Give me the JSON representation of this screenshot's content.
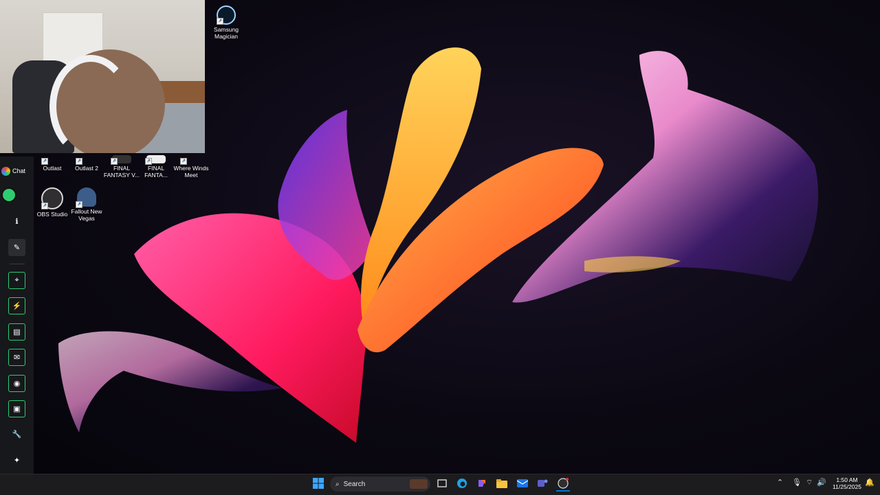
{
  "desktop": {
    "icons": [
      {
        "label": "Samsung Magician",
        "icon": "samsung-magician-icon"
      },
      {
        "label": "Outlast",
        "icon": "outlast-icon"
      },
      {
        "label": "Outlast 2",
        "icon": "outlast-2-icon"
      },
      {
        "label": "FINAL FANTASY V...",
        "icon": "final-fantasy-icon"
      },
      {
        "label": "FINAL FANTA...",
        "icon": "final-fantasy-2-icon"
      },
      {
        "label": "Where Winds Meet",
        "icon": "where-winds-meet-icon"
      },
      {
        "label": "OBS Studio",
        "icon": "obs-studio-icon"
      },
      {
        "label": "Fallout New Vegas",
        "icon": "fallout-new-vegas-icon"
      }
    ]
  },
  "rail": {
    "chat_label": "Chat",
    "tools": [
      {
        "name": "info",
        "glyph": "ℹ"
      },
      {
        "name": "edit",
        "glyph": "✎"
      },
      {
        "name": "screenshot",
        "glyph": "⌖"
      },
      {
        "name": "flash",
        "glyph": "⚡"
      },
      {
        "name": "notes",
        "glyph": "▤"
      },
      {
        "name": "message",
        "glyph": "✉"
      },
      {
        "name": "broadcast",
        "glyph": "◉"
      },
      {
        "name": "layers",
        "glyph": "▣"
      },
      {
        "name": "wrench",
        "glyph": "🔧"
      },
      {
        "name": "apps",
        "glyph": "✦"
      }
    ]
  },
  "taskbar": {
    "search_placeholder": "Search",
    "apps": [
      "start-icon",
      "search-icon",
      "task-view-icon",
      "edge-icon",
      "copilot-icon",
      "file-explorer-icon",
      "outlook-icon",
      "teams-icon",
      "obs-taskbar-icon"
    ],
    "clock_time": "1:50 AM",
    "clock_date": "11/25/2025",
    "accent": "#0078d4"
  }
}
